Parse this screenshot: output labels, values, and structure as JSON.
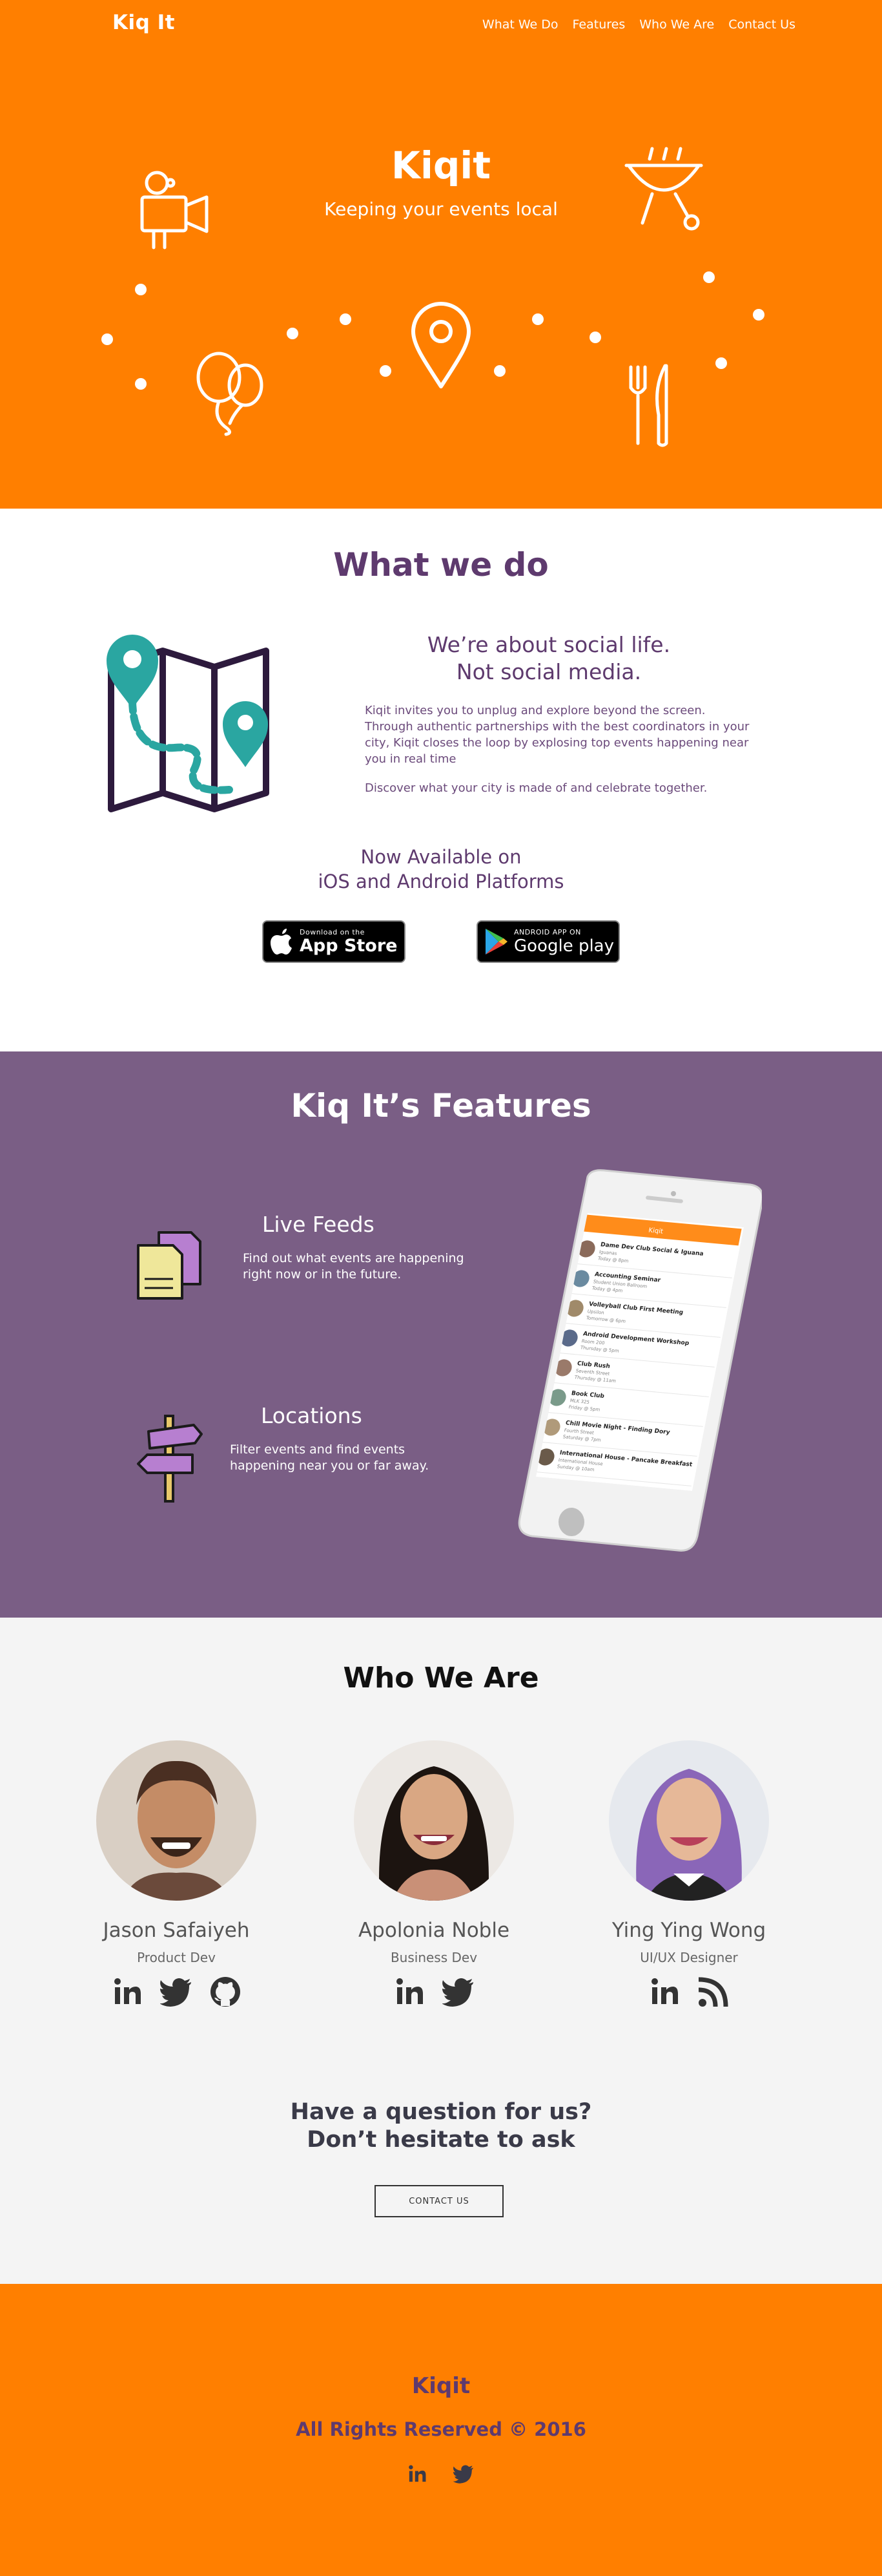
{
  "nav": {
    "brand": "Kiq It",
    "links": [
      "What We Do",
      "Features",
      "Who We Are",
      "Contact Us"
    ]
  },
  "hero": {
    "title": "Kiqit",
    "subtitle": "Keeping your events local",
    "icons": [
      "movie-camera-icon",
      "grill-icon",
      "balloons-icon",
      "location-pin-icon",
      "fork-knife-icon"
    ]
  },
  "what": {
    "heading": "What we do",
    "tagline_1": "We’re about social life.",
    "tagline_2": "Not social media.",
    "description": "Kiqit invites you to unplug and explore beyond the screen. Through authentic partnerships with the best coordinators in your city, Kiqit closes the loop by explosing top events happening near you in real time",
    "discover": "Discover what your city is made of and celebrate together.",
    "available_1": "Now Available on",
    "available_2": "iOS and Android Platforms",
    "appstore": {
      "small": "Download on the",
      "big": "App Store"
    },
    "googleplay": {
      "small": "ANDROID APP ON",
      "big": "Google play"
    }
  },
  "features": {
    "heading": "Kiq It’s Features",
    "items": [
      {
        "title": "Live Feeds",
        "desc_1": "Find out what events are happening",
        "desc_2": "right now or in the future."
      },
      {
        "title": "Locations",
        "desc_1": "Filter events and find events",
        "desc_2": "happening near you or far away."
      }
    ],
    "phone": {
      "header": "Kiqit",
      "events": [
        {
          "title": "Dame Dev Club Social & Iguana",
          "sub": "Iguanas",
          "time": "Today @ 8pm"
        },
        {
          "title": "Accounting Seminar",
          "sub": "Student Union Ballroom",
          "time": "Today @ 4pm"
        },
        {
          "title": "Volleyball Club First Meeting",
          "sub": "Upsilon",
          "time": "Tomorrow @ 6pm"
        },
        {
          "title": "Android Development Workshop",
          "sub": "Room 200",
          "time": "Thursday @ 5pm"
        },
        {
          "title": "Club Rush",
          "sub": "Seventh Street",
          "time": "Thursday @ 11am"
        },
        {
          "title": "Book Club",
          "sub": "MLK 325",
          "time": "Friday @ 5pm"
        },
        {
          "title": "Chill Movie Night - Finding Dory",
          "sub": "Fourth Street",
          "time": "Saturday @ 7pm"
        },
        {
          "title": "International House - Pancake Breakfast",
          "sub": "International House",
          "time": "Sunday @ 10am"
        }
      ]
    }
  },
  "who": {
    "heading": "Who We Are",
    "members": [
      {
        "name": "Jason Safaiyeh",
        "role": "Product Dev",
        "socials": [
          "linkedin-icon",
          "twitter-icon",
          "github-icon"
        ]
      },
      {
        "name": "Apolonia Noble",
        "role": "Business Dev",
        "socials": [
          "linkedin-icon",
          "twitter-icon"
        ]
      },
      {
        "name": "Ying Ying Wong",
        "role": "UI/UX Designer",
        "socials": [
          "linkedin-icon",
          "rss-icon"
        ]
      }
    ],
    "question_1": "Have a question for us?",
    "question_2": "Don’t hesitate to ask",
    "contact_button": "CONTACT US"
  },
  "footer": {
    "brand": "Kiqit",
    "copyright": "All Rights Reserved © 2016",
    "socials": [
      "linkedin-icon",
      "twitter-icon"
    ]
  },
  "colors": {
    "orange": "#ff7f00",
    "purple_dark": "#5e3a6e",
    "purple_section": "#7a5e85",
    "teal": "#2aa6a1",
    "light_gray": "#f4f4f4"
  }
}
